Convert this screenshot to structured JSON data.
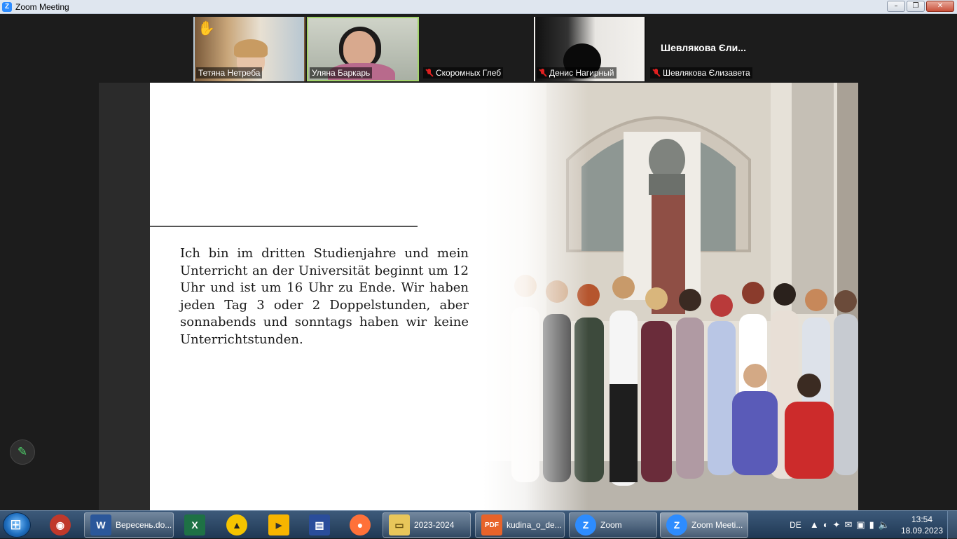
{
  "window": {
    "title": "Zoom Meeting"
  },
  "participants": [
    {
      "name": "Тетяна Нетреба",
      "muted": false,
      "hand_raised": true,
      "video": true,
      "speaking": false
    },
    {
      "name": "Уляна Баркарь",
      "muted": false,
      "hand_raised": false,
      "video": true,
      "speaking": true
    },
    {
      "name": "Скоромных Глеб",
      "muted": true,
      "hand_raised": false,
      "video": false,
      "speaking": false
    },
    {
      "name": "Денис Нагирный",
      "muted": true,
      "hand_raised": false,
      "video": true,
      "speaking": false
    },
    {
      "name": "Шевлякова Єлизавета",
      "display_title": "Шевлякова Єли...",
      "muted": true,
      "hand_raised": false,
      "video": false,
      "speaking": false
    }
  ],
  "slide": {
    "paragraph": "Ich bin im dritten Studienjahre und mein Unterricht an der Universität beginnt um 12 Uhr und ist um 16 Uhr zu Ende. Wir haben jeden Tag 3 oder 2 Doppelstunden, aber sonnabends und sonntags haben wir keine Unterrichtstunden."
  },
  "taskbar": {
    "items": [
      {
        "label": "",
        "icon": "app-icon",
        "color": "#c0392b"
      },
      {
        "label": "Вересень.do...",
        "icon": "word-icon",
        "color": "#2b579a"
      },
      {
        "label": "",
        "icon": "excel-icon",
        "color": "#1e7145"
      },
      {
        "label": "",
        "icon": "aimp-icon",
        "color": "#f5c400"
      },
      {
        "label": "",
        "icon": "player-icon",
        "color": "#f7b500"
      },
      {
        "label": "",
        "icon": "floppy-icon",
        "color": "#2a4d9b"
      },
      {
        "label": "",
        "icon": "firefox-icon",
        "color": "#ff7139"
      },
      {
        "label": "2023-2024",
        "icon": "folder-icon",
        "color": "#e8c65a"
      },
      {
        "label": "kudina_o_de...",
        "icon": "pdf-icon",
        "color": "#e8632a"
      },
      {
        "label": "Zoom",
        "icon": "zoom-icon",
        "color": "#2d8cff"
      },
      {
        "label": "Zoom Meeti...",
        "icon": "zoom-icon",
        "color": "#2d8cff"
      }
    ],
    "language": "DE",
    "time": "13:54",
    "date": "18.09.2023"
  }
}
